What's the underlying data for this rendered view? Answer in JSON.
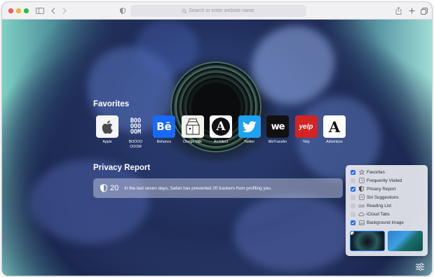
{
  "toolbar": {
    "address_placeholder": "Search or enter website name"
  },
  "favorites": {
    "title": "Favorites",
    "items": [
      {
        "label": "Apple",
        "icon": "apple-logo-icon"
      },
      {
        "label": "BOOOO\nOOOM",
        "tile_text": "BOO\nOOO\nOOM",
        "icon": "booooooom-logo-icon"
      },
      {
        "label": "Behance",
        "tile_text": "Bē",
        "icon": "behance-logo-icon"
      },
      {
        "label": "Design Milk",
        "icon": "design-milk-logo-icon"
      },
      {
        "label": "Architect",
        "tile_text": "A",
        "icon": "architect-logo-icon"
      },
      {
        "label": "Twitter",
        "icon": "twitter-bird-icon"
      },
      {
        "label": "WeTransfer",
        "tile_text": "we",
        "icon": "wetransfer-logo-icon"
      },
      {
        "label": "Yelp",
        "tile_text": "yelp",
        "icon": "yelp-logo-icon"
      },
      {
        "label": "Adventure",
        "tile_text": "A",
        "icon": "adventure-logo-icon"
      }
    ]
  },
  "privacy": {
    "title": "Privacy Report",
    "count": "20",
    "message": "In the last seven days, Safari has prevented 20 trackers from profiling you."
  },
  "customize": {
    "options": [
      {
        "label": "Favorites",
        "checked": true,
        "icon": "star-icon"
      },
      {
        "label": "Frequently Visited",
        "checked": false,
        "icon": "clock-icon"
      },
      {
        "label": "Privacy Report",
        "checked": true,
        "icon": "shield-icon"
      },
      {
        "label": "Siri Suggestions",
        "checked": false,
        "icon": "siri-icon"
      },
      {
        "label": "Reading List",
        "checked": false,
        "icon": "glasses-icon"
      },
      {
        "label": "iCloud Tabs",
        "checked": false,
        "icon": "cloud-icon"
      },
      {
        "label": "Background Image",
        "checked": true,
        "icon": "image-icon"
      }
    ]
  },
  "colors": {
    "accent": "#1f6fe8",
    "behance": "#1769ff",
    "twitter": "#1da1f2",
    "yelp": "#d32323"
  }
}
